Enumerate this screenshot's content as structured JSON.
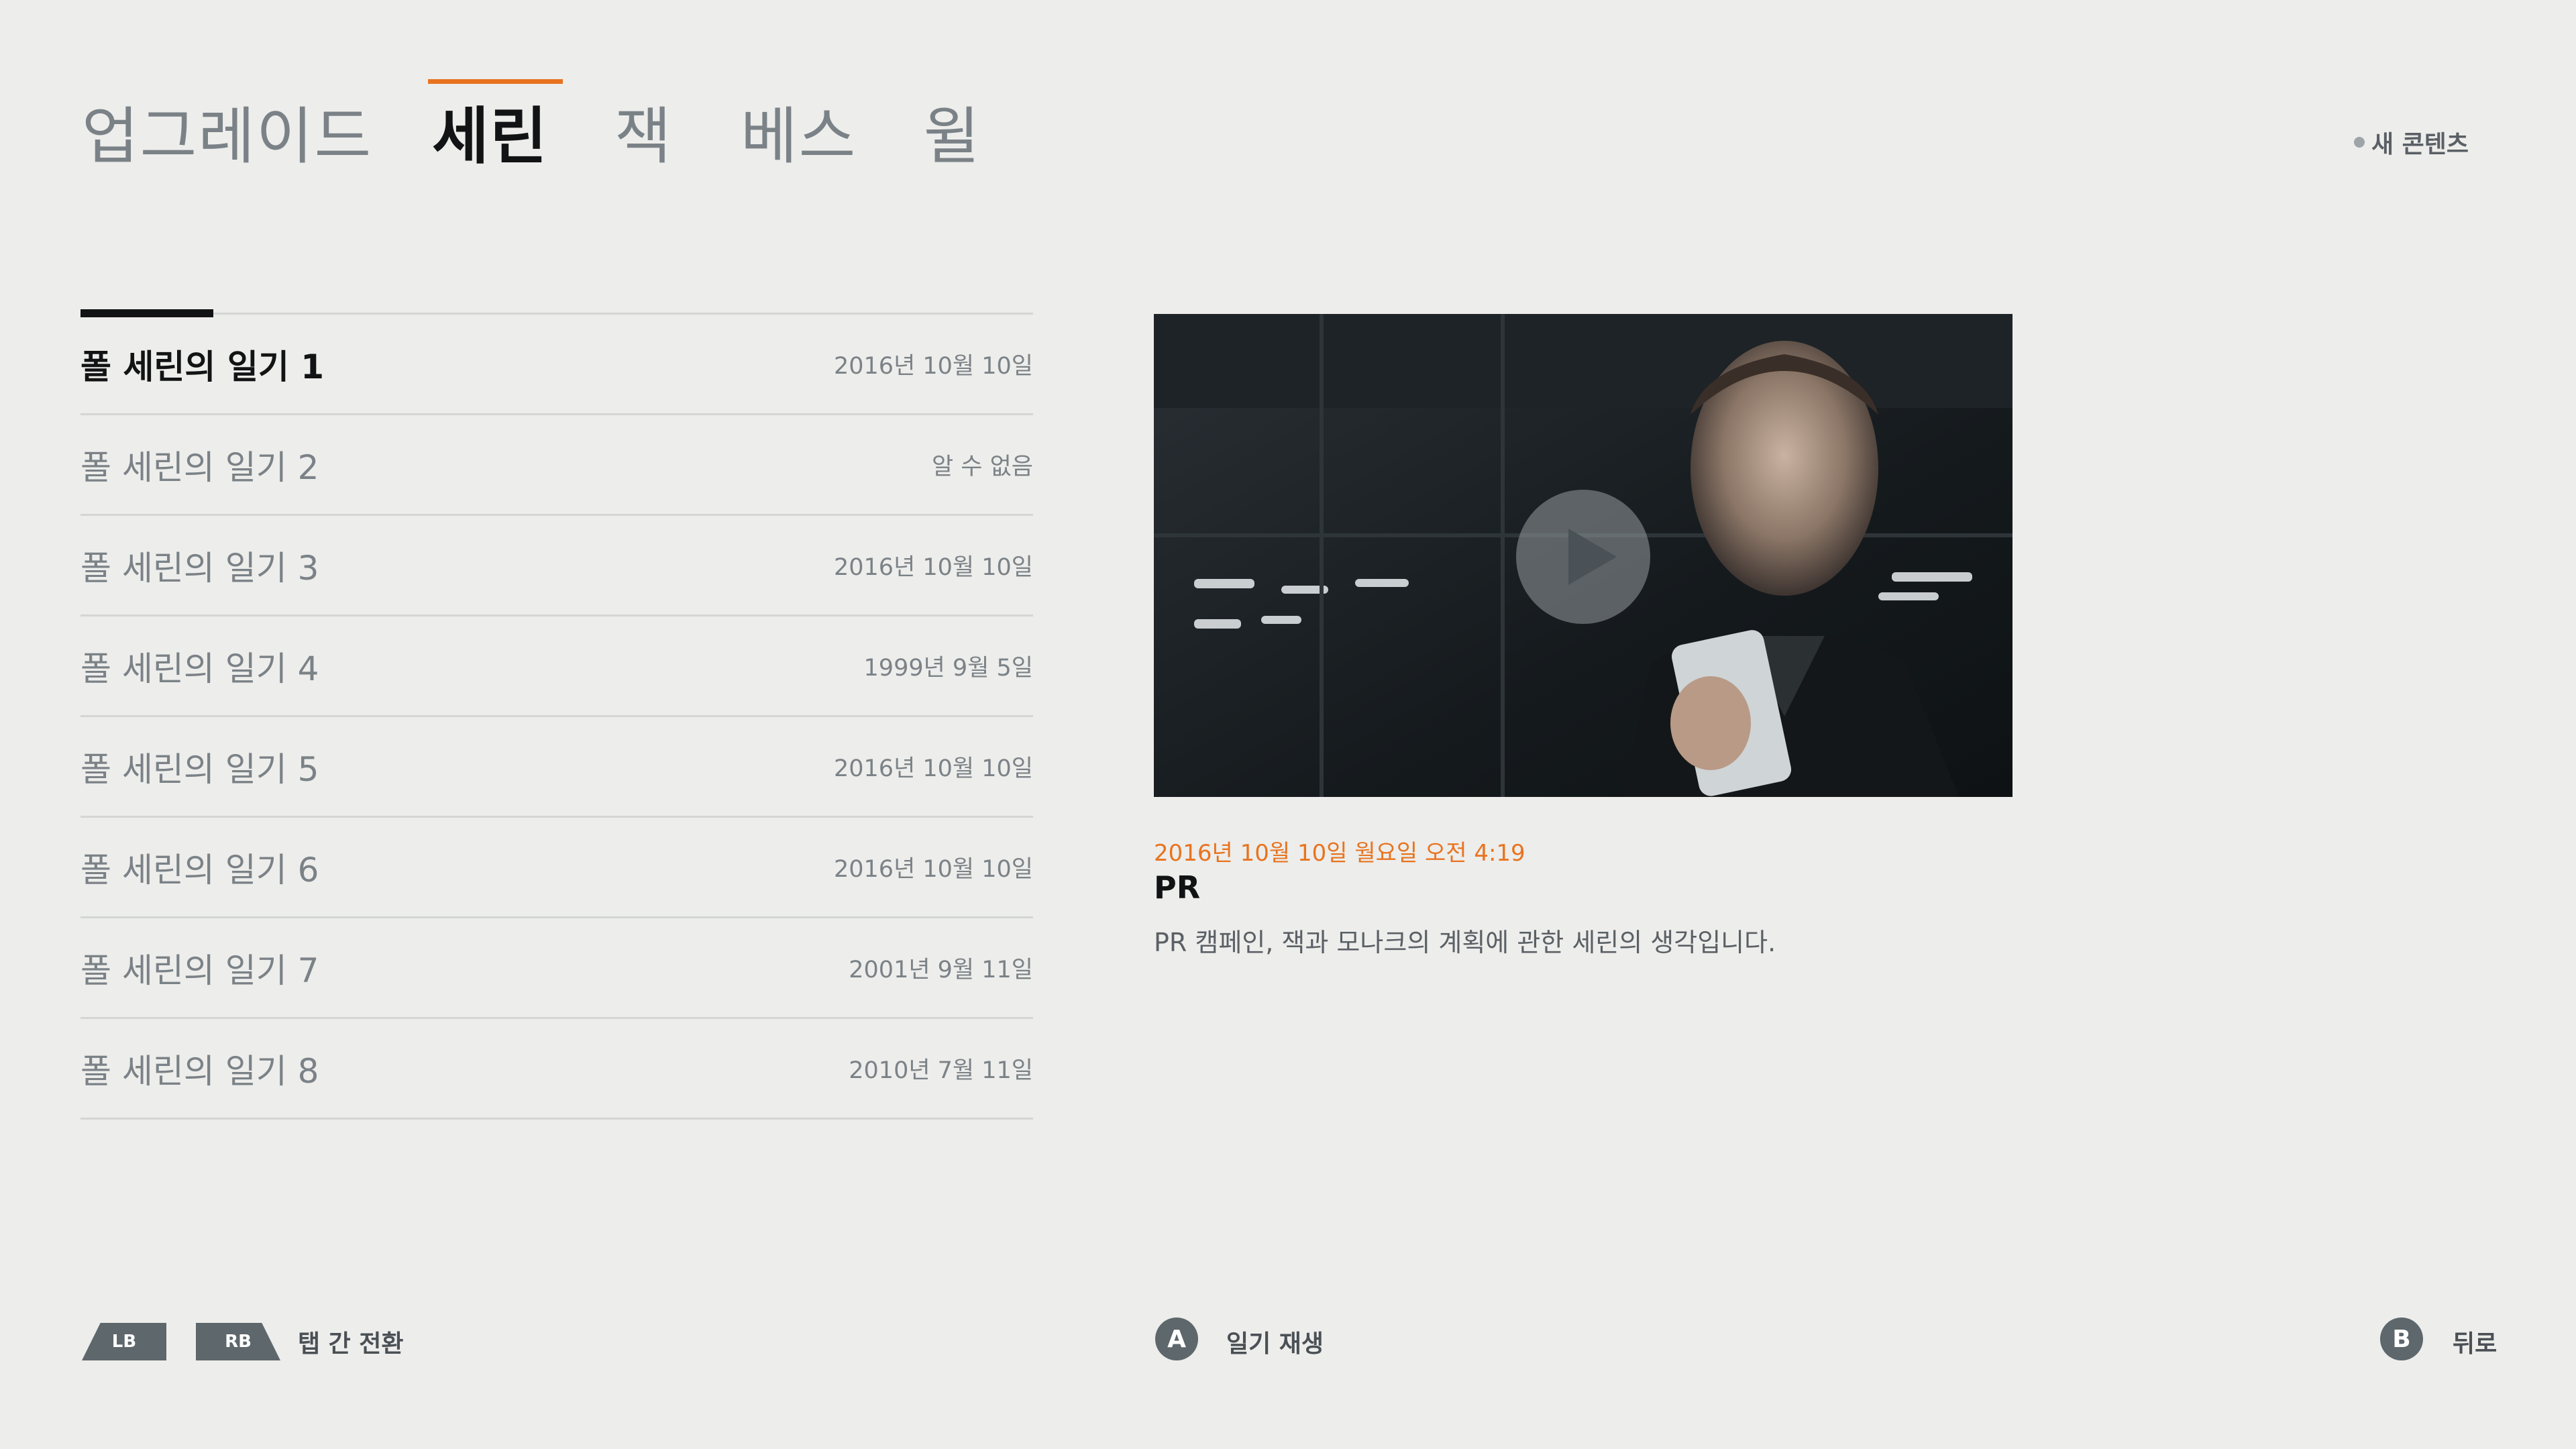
{
  "tabs": [
    {
      "label": "업그레이드"
    },
    {
      "label": "세린"
    },
    {
      "label": "잭"
    },
    {
      "label": "베스"
    },
    {
      "label": "윌"
    }
  ],
  "active_tab": "세린",
  "new_content_label": "새 콘텐츠",
  "entries": [
    {
      "title": "폴 세린의 일기 1",
      "date": "2016년 10월 10일"
    },
    {
      "title": "폴 세린의 일기 2",
      "date": "알 수 없음"
    },
    {
      "title": "폴 세린의 일기 3",
      "date": "2016년 10월 10일"
    },
    {
      "title": "폴 세린의 일기 4",
      "date": "1999년 9월 5일"
    },
    {
      "title": "폴 세린의 일기 5",
      "date": "2016년 10월 10일"
    },
    {
      "title": "폴 세린의 일기 6",
      "date": "2016년 10월 10일"
    },
    {
      "title": "폴 세린의 일기 7",
      "date": "2001년 9월 11일"
    },
    {
      "title": "폴 세린의 일기 8",
      "date": "2010년 7월 11일"
    }
  ],
  "detail": {
    "timestamp": "2016년 10월 10일 월요일 오전 4:19",
    "title": "PR",
    "description": "PR 캠페인, 잭과 모나크의 계획에 관한 세린의 생각입니다."
  },
  "footer": {
    "lb": "LB",
    "rb": "RB",
    "switch_tabs": "탭 간 전환",
    "a": "A",
    "play_label": "일기 재생",
    "b": "B",
    "back_label": "뒤로"
  },
  "colors": {
    "accent": "#e8731f",
    "background": "#ededeb",
    "button": "#5d676c"
  }
}
